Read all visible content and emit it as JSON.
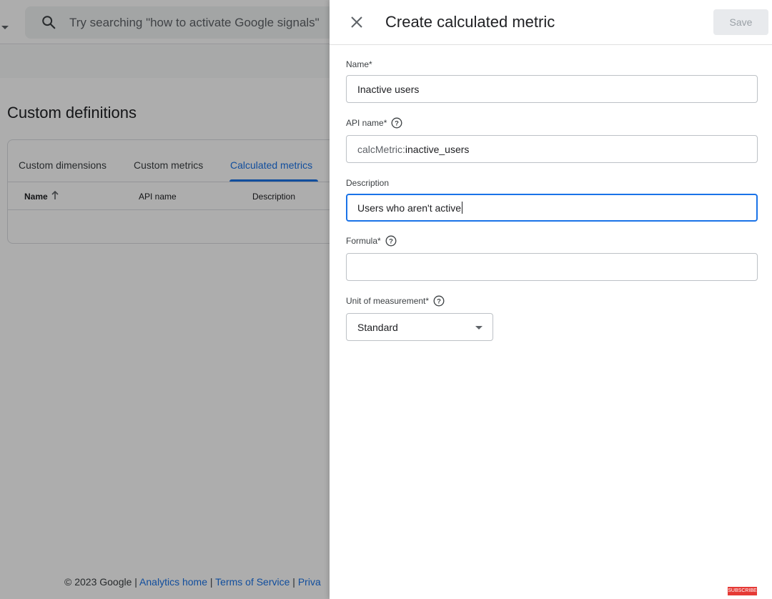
{
  "background": {
    "search": {
      "placeholder": "Try searching \"how to activate Google signals\""
    },
    "page_title": "Custom definitions",
    "tabs": [
      {
        "label": "Custom dimensions",
        "active": false
      },
      {
        "label": "Custom metrics",
        "active": false
      },
      {
        "label": "Calculated metrics",
        "active": true
      }
    ],
    "table": {
      "columns": [
        "Name",
        "API name",
        "Description"
      ],
      "sorted_column": "Name",
      "sort_direction": "ascending"
    },
    "footer": {
      "copyright": "© 2023 Google",
      "links": [
        "Analytics home",
        "Terms of Service",
        "Priva"
      ]
    }
  },
  "panel": {
    "title": "Create calculated metric",
    "save_label": "Save",
    "fields": {
      "name": {
        "label": "Name*",
        "value": "Inactive users"
      },
      "api_name": {
        "label": "API name*",
        "prefix": "calcMetric:",
        "value": "inactive_users"
      },
      "description": {
        "label": "Description",
        "value": "Users who aren't active"
      },
      "formula": {
        "label": "Formula*",
        "value": ""
      },
      "unit": {
        "label": "Unit of measurement*",
        "value": "Standard"
      }
    }
  },
  "badge": "SUBSCRIBE",
  "colors": {
    "accent": "#1a73e8",
    "scrim": "rgba(0,0,0,0.32)",
    "badge": "#e53935"
  },
  "icons": [
    "search-icon",
    "close-icon",
    "help-icon",
    "arrow-up-icon",
    "dropdown-arrow-icon",
    "caret-down-icon"
  ]
}
